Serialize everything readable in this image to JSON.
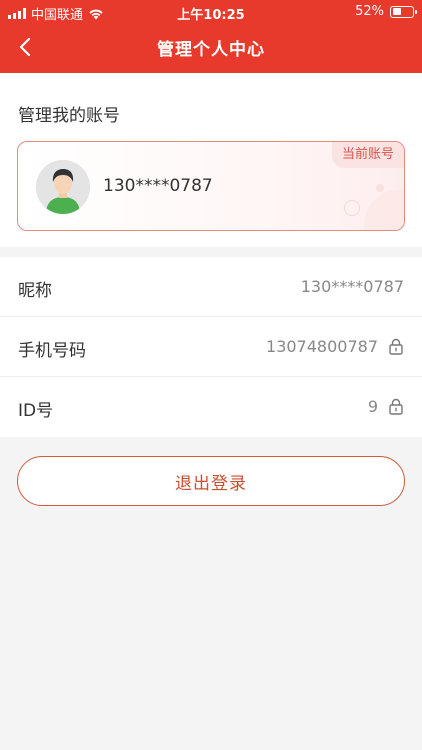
{
  "status_bar": {
    "carrier": "中国联通",
    "time": "上午10:25",
    "battery": "52%",
    "battery_level": 0.52
  },
  "nav": {
    "title": "管理个人中心",
    "back_icon": "chevron-left-icon"
  },
  "account_section": {
    "title": "管理我的账号",
    "current_badge": "当前账号",
    "account_name": "130****0787"
  },
  "info": {
    "rows": [
      {
        "label": "昵称",
        "value": "130****0787",
        "locked": false
      },
      {
        "label": "手机号码",
        "value": "13074800787",
        "locked": true
      },
      {
        "label": "ID号",
        "value": "9",
        "locked": true
      }
    ]
  },
  "logout_label": "退出登录",
  "colors": {
    "header": "#e83a2c",
    "accent": "#c9502f",
    "avatar_shirt": "#4caf50"
  }
}
